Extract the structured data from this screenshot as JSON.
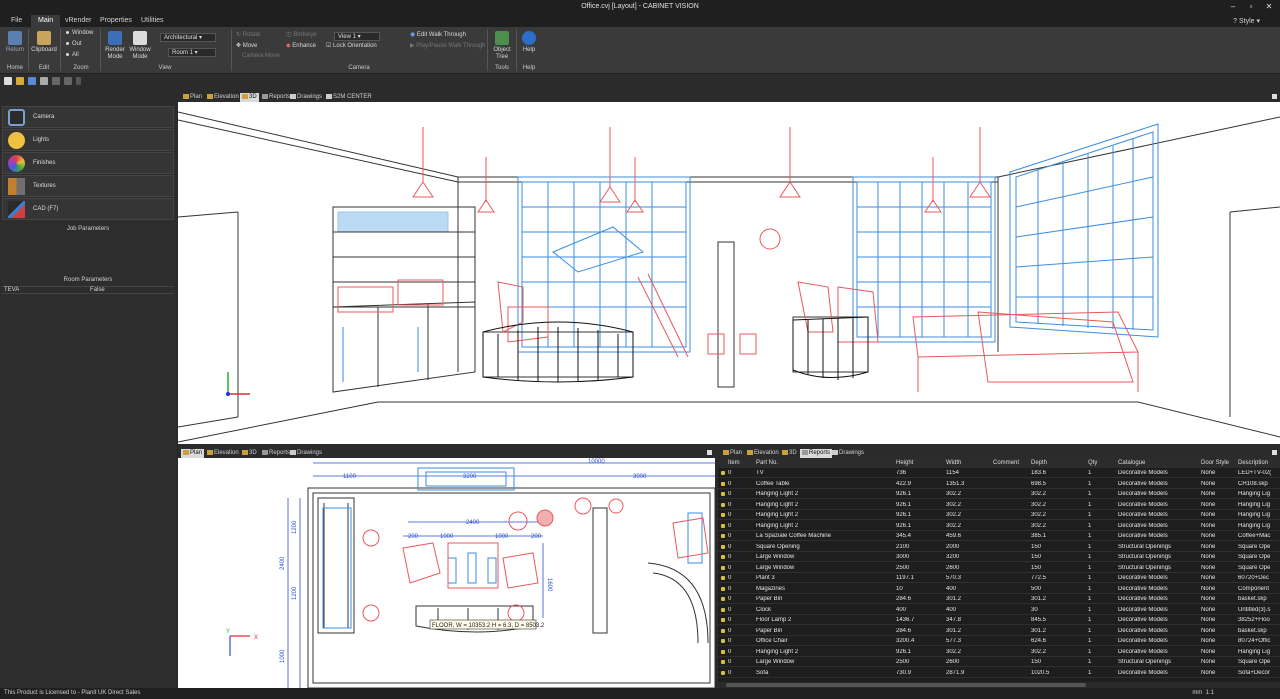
{
  "window": {
    "title": "Office.cvj [Layout] - CABINET VISION",
    "minimize": "–",
    "restore": "▫",
    "close": "✕"
  },
  "ribbon": {
    "tabs": [
      "File",
      "Main",
      "vRender",
      "Properties",
      "Utilities"
    ],
    "active_tab": "Main",
    "style_label": "Style",
    "buttons": {
      "return": "Return",
      "clipboard": "Clipboard",
      "window": "Window",
      "out": "Out",
      "all": "All",
      "render_mode": "Render Mode",
      "window_mode": "Window Mode",
      "architectural": "Architectural",
      "room": "Room 1",
      "rotate": "Rotate",
      "move": "Move",
      "camera_move": "Camera Move",
      "birdseye": "Birdseye",
      "enhance": "Enhance",
      "view": "View 1",
      "lock_orientation": "Lock Orientation",
      "edit_walk": "Edit Walk Through",
      "play_walk": "Play/Pause Walk Through",
      "object_tree": "Object Tree",
      "help": "Help"
    },
    "groups": {
      "home": "Home",
      "edit": "Edit",
      "zoom": "Zoom",
      "view": "View",
      "camera": "Camera",
      "tools": "Tools",
      "help": "Help"
    }
  },
  "left_panel": {
    "items": [
      {
        "label": "Camera",
        "icon": "camera-icon"
      },
      {
        "label": "Lights",
        "icon": "bulb-icon"
      },
      {
        "label": "Finishes",
        "icon": "palette-icon"
      },
      {
        "label": "Textures",
        "icon": "texture-icon"
      },
      {
        "label": "CAD (F7)",
        "icon": "cad-icon"
      }
    ],
    "job_parameters": "Job Parameters",
    "room_parameters": "Room Parameters",
    "param_row": {
      "name": "TEVA",
      "value": "False"
    }
  },
  "tabs_3d": [
    "Plan",
    "Elevation",
    "3D",
    "Reports",
    "Drawings",
    "S2M CENTER"
  ],
  "active_3d_tab": "3D",
  "tabs_plan": [
    "Plan",
    "Elevation",
    "3D",
    "Reports",
    "Drawings"
  ],
  "active_plan_tab": "Plan",
  "tabs_report": [
    "Plan",
    "Elevation",
    "3D",
    "Reports",
    "Drawings"
  ],
  "active_report_tab": "Reports",
  "plan_dims": {
    "d10000": "10000",
    "d1100": "1100",
    "d3200": "3200",
    "d3000": "3000",
    "d2400": "2400",
    "d200a": "200",
    "d1000a": "1000",
    "d1000b": "1000",
    "d200b": "200",
    "v1200": "1200",
    "v2400": "2400",
    "v1200b": "1200",
    "v1000": "1000",
    "v1600": "1600",
    "tooltip": "FLOOR, W = 10353.2  H = 6.3, D = 8503.2",
    "axis_x": "X",
    "axis_y": "Y"
  },
  "report": {
    "columns": [
      "Item",
      "Part No.",
      "Height",
      "Width",
      "Comment",
      "Depth",
      "Qty",
      "Catalogue",
      "Door Style",
      "Description"
    ],
    "rows": [
      [
        "0",
        "TV",
        "736",
        "1154",
        "",
        "183.6",
        "1",
        "Decorative Models",
        "None",
        "LED+TV-02("
      ],
      [
        "0",
        "Coffee Table",
        "422.9",
        "1351.3",
        "",
        "698.5",
        "1",
        "Decorative Models",
        "None",
        "CH108.skp"
      ],
      [
        "0",
        "Hanging Light 2",
        "926.1",
        "302.2",
        "",
        "302.2",
        "1",
        "Decorative Models",
        "None",
        "Hanging Lig"
      ],
      [
        "0",
        "Hanging Light 2",
        "926.1",
        "302.2",
        "",
        "302.2",
        "1",
        "Decorative Models",
        "None",
        "Hanging Lig"
      ],
      [
        "0",
        "Hanging Light 2",
        "926.1",
        "302.2",
        "",
        "302.2",
        "1",
        "Decorative Models",
        "None",
        "Hanging Lig"
      ],
      [
        "0",
        "Hanging Light 2",
        "926.1",
        "302.2",
        "",
        "302.2",
        "1",
        "Decorative Models",
        "None",
        "Hanging Lig"
      ],
      [
        "0",
        "La Spaziale Coffee Machine",
        "345.4",
        "459.6",
        "",
        "385.1",
        "1",
        "Decorative Models",
        "None",
        "Coffee+Mac"
      ],
      [
        "0",
        "Square Opening",
        "2100",
        "2000",
        "",
        "150",
        "1",
        "Structural Openings",
        "None",
        "Square Ope"
      ],
      [
        "0",
        "Large Window",
        "3000",
        "3200",
        "",
        "150",
        "1",
        "Structural Openings",
        "None",
        "Square Ope"
      ],
      [
        "0",
        "Large Window",
        "2500",
        "2600",
        "",
        "150",
        "1",
        "Structural Openings",
        "None",
        "Square Ope"
      ],
      [
        "0",
        "Plant 3",
        "1197.1",
        "570.3",
        "",
        "772.5",
        "1",
        "Decorative Models",
        "None",
        "60720+Dec"
      ],
      [
        "0",
        "Magazines",
        "10",
        "400",
        "",
        "500",
        "1",
        "Decorative Models",
        "None",
        "Component"
      ],
      [
        "0",
        "Paper Bin",
        "284.6",
        "301.2",
        "",
        "301.2",
        "1",
        "Decorative Models",
        "None",
        "basket.skp"
      ],
      [
        "0",
        "Clock",
        "400",
        "400",
        "",
        "30",
        "1",
        "Decorative Models",
        "None",
        "Untitled(3).s"
      ],
      [
        "0",
        "Floor Lamp 2",
        "1436.7",
        "347.8",
        "",
        "845.5",
        "1",
        "Decorative Models",
        "None",
        "38252+Floo"
      ],
      [
        "0",
        "Paper Bin",
        "284.6",
        "301.2",
        "",
        "301.2",
        "1",
        "Decorative Models",
        "None",
        "basket.skp"
      ],
      [
        "0",
        "Office Chair",
        "3200.4",
        "577.3",
        "",
        "624.6",
        "1",
        "Decorative Models",
        "None",
        "80724+Offic"
      ],
      [
        "0",
        "Hanging Light 2",
        "926.1",
        "302.2",
        "",
        "302.2",
        "1",
        "Decorative Models",
        "None",
        "Hanging Lig"
      ],
      [
        "0",
        "Large Window",
        "2500",
        "2600",
        "",
        "150",
        "1",
        "Structural Openings",
        "None",
        "Square Ope"
      ],
      [
        "0",
        "Sofa",
        "730.9",
        "2871.9",
        "",
        "1020.5",
        "1",
        "Decorative Models",
        "None",
        "Sofa+Decor"
      ]
    ]
  },
  "status": {
    "message": "This Product is Licensed to - Planit UK Direct Sales",
    "zoom_label": "mm",
    "zoom_value": "1:1"
  }
}
